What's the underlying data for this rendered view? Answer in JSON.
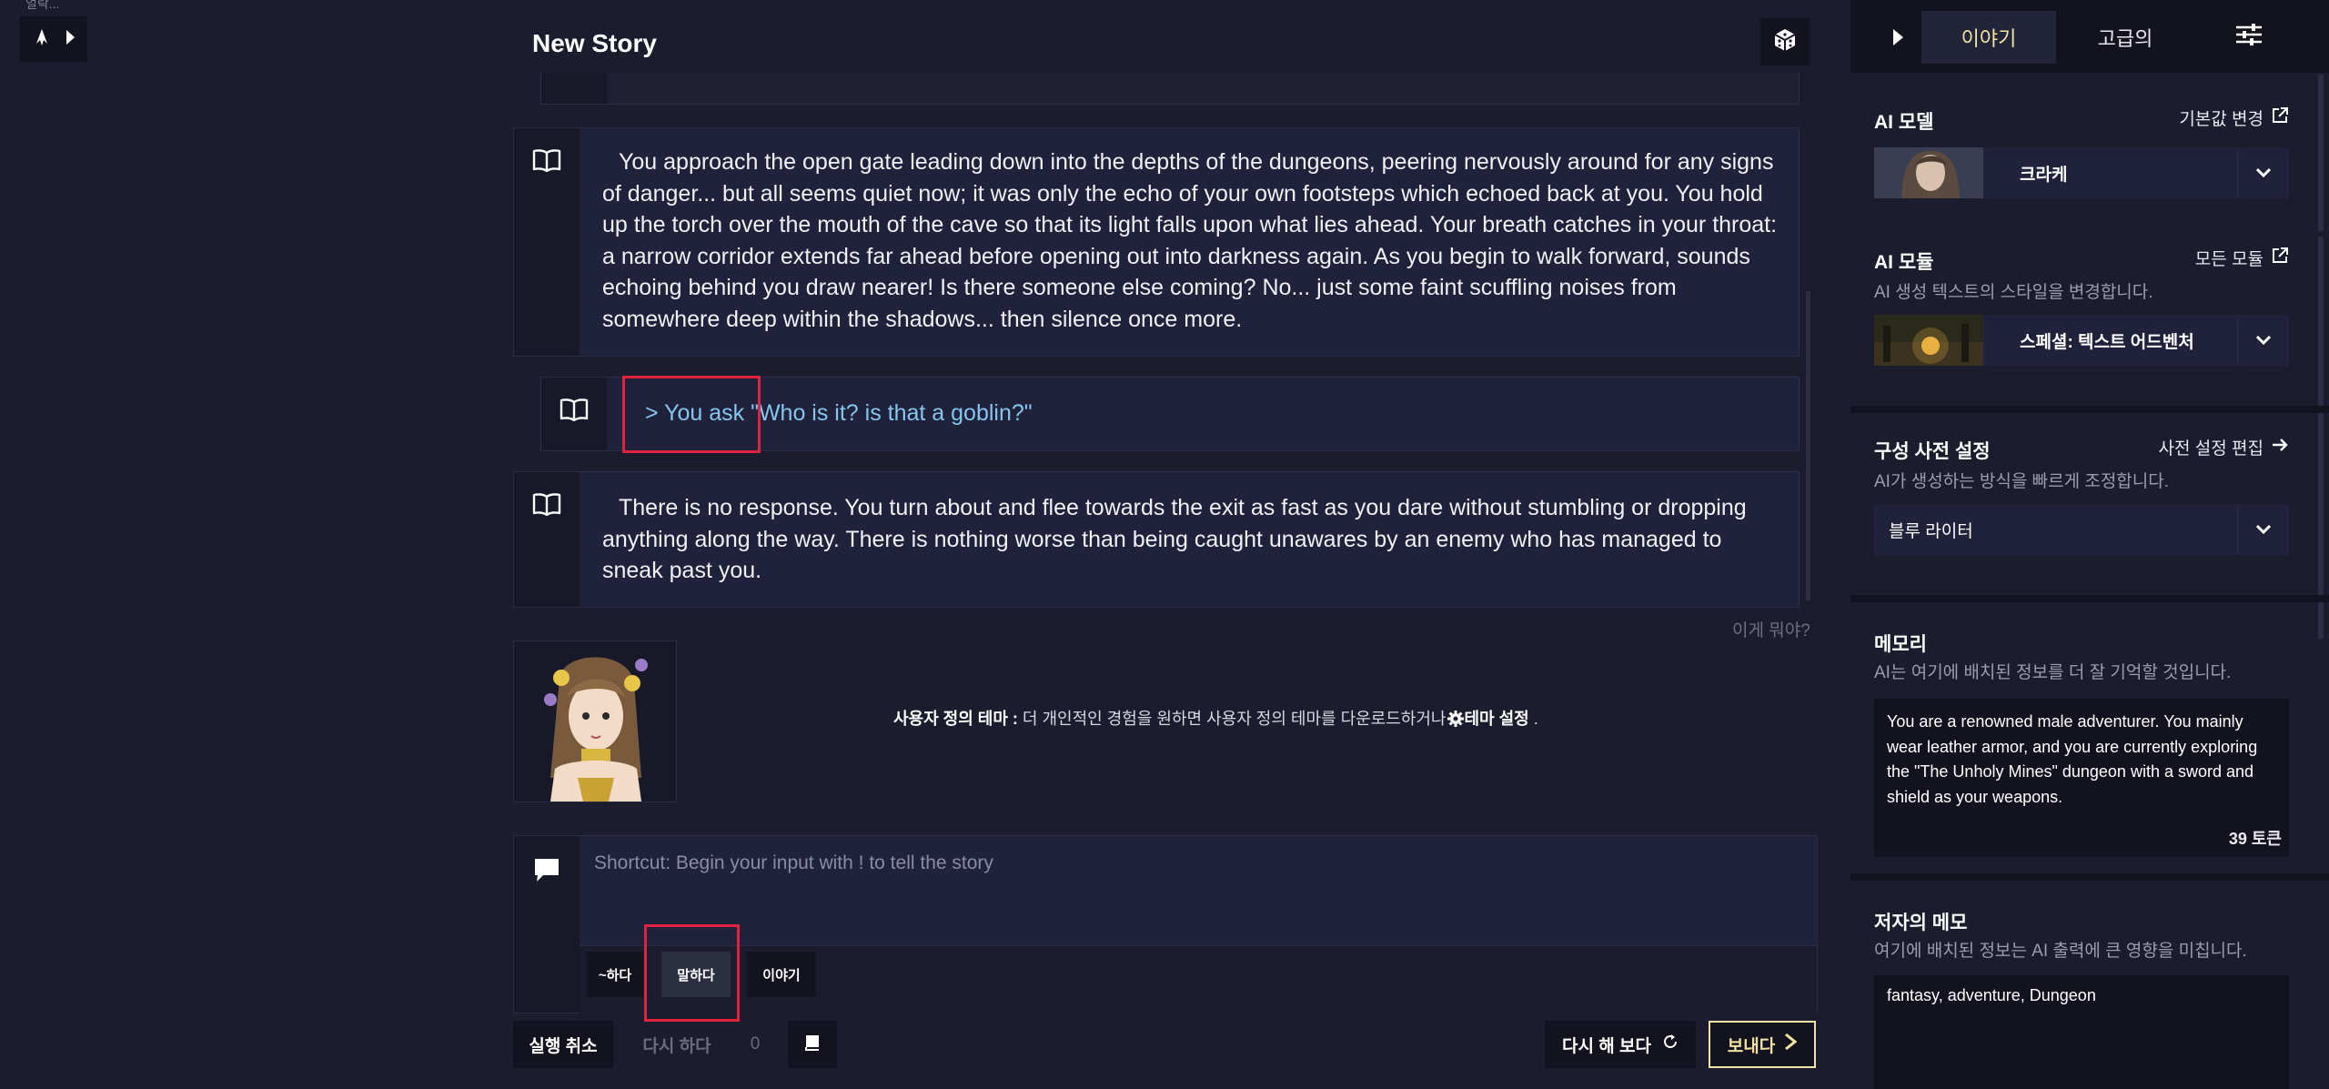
{
  "left_panel": {
    "tiny_label": "얼락..."
  },
  "story": {
    "title": "New Story",
    "blocks": [
      {
        "type": "story",
        "text": "You approach the open gate leading down into the depths of the dungeons, peering nervously around for any signs of danger... but all seems quiet now; it was only the echo of your own footsteps which echoed back at you. You hold up the torch over the mouth of the cave so that its light falls upon what lies ahead. Your breath catches in your throat: a narrow corridor extends far ahead before opening out into darkness again. As you begin to walk forward, sounds echoing behind you draw nearer! Is there someone else coming? No... just some faint scuffling noises from somewhere deep within the shadows... then silence once more."
      },
      {
        "type": "action",
        "text": "> You ask \"Who is it? is that a goblin?\""
      },
      {
        "type": "story",
        "text": "There is no response. You turn about and flee towards the exit as fast as you dare without stumbling or dropping anything along the way. There is nothing worse than being caught unawares by an enemy who has managed to sneak past you."
      }
    ],
    "whats_this": "이게 뭐야?",
    "theme_notice": {
      "bold": "사용자 정의 테마 :",
      "text": " 더 개인적인 경험을 원하면 사용자 정의 테마를 다운로드하거나",
      "link": "테마 설정",
      "end": " ."
    }
  },
  "input": {
    "placeholder": "Shortcut: Begin your input with ! to tell the story",
    "modes": [
      "~하다",
      "말하다",
      "이야기"
    ],
    "selected_mode": "말하다"
  },
  "actions": {
    "undo": "실행 취소",
    "redo": "다시 하다",
    "redo_count": "0",
    "retry": "다시 해 보다",
    "send": "보내다"
  },
  "right_panel": {
    "tabs": [
      "이야기",
      "고급의"
    ],
    "active_tab": "이야기",
    "ai_model": {
      "title": "AI 모델",
      "link": "기본값 변경",
      "selected": "크라케"
    },
    "ai_module": {
      "title": "AI 모듈",
      "link": "모든 모듈",
      "subtitle": "AI 생성 텍스트의 스타일을 변경합니다.",
      "selected": "스페셜: 텍스트 어드벤처"
    },
    "preset": {
      "title": "구성 사전 설정",
      "link": "사전 설정 편집",
      "subtitle": "AI가 생성하는 방식을 빠르게 조정합니다.",
      "selected": "블루 라이터"
    },
    "memory": {
      "title": "메모리",
      "subtitle": "AI는 여기에 배치된 정보를 더 잘 기억할 것입니다.",
      "text": "You are a renowned male adventurer. You mainly wear leather armor, and you are currently exploring the \"The Unholy Mines\" dungeon with a sword and shield as your weapons.",
      "tokens": "39 토큰"
    },
    "authors_note": {
      "title": "저자의 메모",
      "subtitle": "여기에 배치된 정보는 AI 출력에 큰 영향을 미칩니다.",
      "text": "fantasy, adventure, Dungeon"
    }
  },
  "colors": {
    "accent": "#f2e3a3",
    "action_text": "#86c5f0",
    "highlight": "#e0223f",
    "bg": "#1b1c2e"
  }
}
